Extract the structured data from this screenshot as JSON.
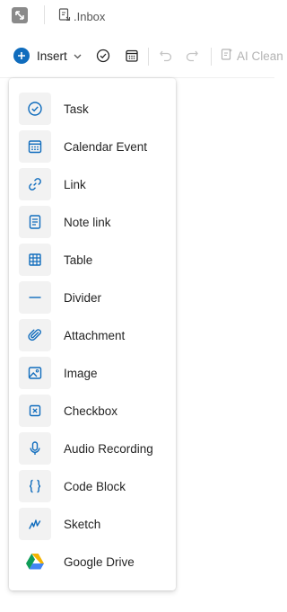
{
  "breadcrumb": {
    "label": ".Inbox"
  },
  "toolbar": {
    "insert_label": "Insert",
    "ai_clean_label": "AI Clean"
  },
  "colors": {
    "accent": "#0f6cbd",
    "icon_tile": "#f2f2f2"
  },
  "insert_menu": {
    "items": [
      {
        "label": "Task",
        "icon": "task-check-circle-icon"
      },
      {
        "label": "Calendar Event",
        "icon": "calendar-icon"
      },
      {
        "label": "Link",
        "icon": "link-icon"
      },
      {
        "label": "Note link",
        "icon": "note-icon"
      },
      {
        "label": "Table",
        "icon": "table-icon"
      },
      {
        "label": "Divider",
        "icon": "divider-icon"
      },
      {
        "label": "Attachment",
        "icon": "paperclip-icon"
      },
      {
        "label": "Image",
        "icon": "image-icon"
      },
      {
        "label": "Checkbox",
        "icon": "checkbox-icon"
      },
      {
        "label": "Audio Recording",
        "icon": "microphone-icon"
      },
      {
        "label": "Code Block",
        "icon": "code-braces-icon"
      },
      {
        "label": "Sketch",
        "icon": "sketch-icon"
      },
      {
        "label": "Google Drive",
        "icon": "google-drive-icon"
      }
    ]
  }
}
